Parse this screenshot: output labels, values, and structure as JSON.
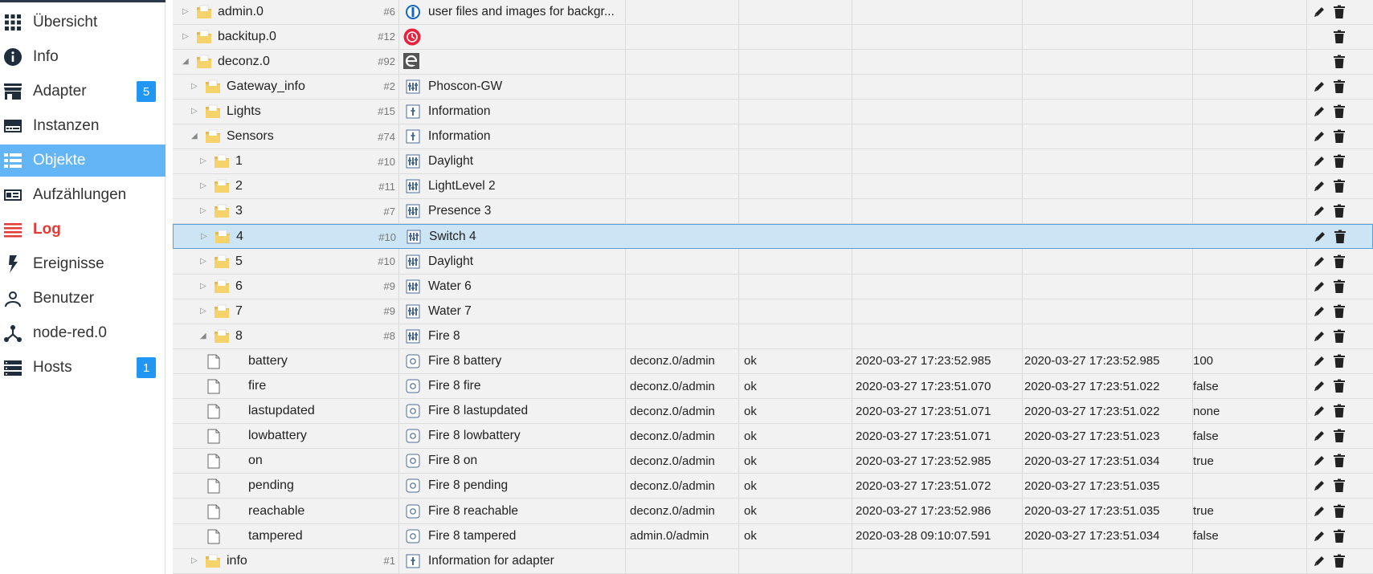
{
  "nav": [
    {
      "label": "Übersicht",
      "icon": "grid-icon"
    },
    {
      "label": "Info",
      "icon": "info-icon"
    },
    {
      "label": "Adapter",
      "icon": "store-icon",
      "badge": "5"
    },
    {
      "label": "Instanzen",
      "icon": "instances-icon"
    },
    {
      "label": "Objekte",
      "icon": "list-icon",
      "active": true
    },
    {
      "label": "Aufzählungen",
      "icon": "enum-icon"
    },
    {
      "label": "Log",
      "icon": "log-icon"
    },
    {
      "label": "Ereignisse",
      "icon": "bolt-icon"
    },
    {
      "label": "Benutzer",
      "icon": "user-icon"
    },
    {
      "label": "node-red.0",
      "icon": "node-red-icon"
    },
    {
      "label": "Hosts",
      "icon": "hosts-icon",
      "badge": "1"
    }
  ],
  "rows": [
    {
      "name": "admin.0",
      "count": "#6",
      "desc": "user files and images for backgr...",
      "type_icon": "admin-logo-icon",
      "toggle": "collapsed",
      "kind": "folder",
      "level": 0
    },
    {
      "name": "backitup.0",
      "count": "#12",
      "desc": "",
      "type_icon": "backitup-logo-icon",
      "toggle": "collapsed",
      "kind": "folder",
      "level": 0
    },
    {
      "name": "deconz.0",
      "count": "#92",
      "desc": "",
      "type_icon": "deconz-logo-icon",
      "toggle": "expanded",
      "kind": "folder",
      "level": 0
    },
    {
      "name": "Gateway_info",
      "count": "#2",
      "desc": "Phoscon-GW",
      "type_icon": "device-icon",
      "toggle": "collapsed",
      "kind": "folder",
      "level": 1
    },
    {
      "name": "Lights",
      "count": "#15",
      "desc": "Information",
      "type_icon": "channel-icon",
      "toggle": "collapsed",
      "kind": "folder",
      "level": 1
    },
    {
      "name": "Sensors",
      "count": "#74",
      "desc": "Information",
      "type_icon": "channel-icon",
      "toggle": "expanded",
      "kind": "folder",
      "level": 1
    },
    {
      "name": "1",
      "count": "#10",
      "desc": "Daylight",
      "type_icon": "device-icon",
      "toggle": "collapsed",
      "kind": "folder",
      "level": 2
    },
    {
      "name": "2",
      "count": "#11",
      "desc": "LightLevel 2",
      "type_icon": "device-icon",
      "toggle": "collapsed",
      "kind": "folder",
      "level": 2
    },
    {
      "name": "3",
      "count": "#7",
      "desc": "Presence 3",
      "type_icon": "device-icon",
      "toggle": "collapsed",
      "kind": "folder",
      "level": 2
    },
    {
      "name": "4",
      "count": "#10",
      "desc": "Switch 4",
      "type_icon": "device-icon",
      "toggle": "collapsed",
      "kind": "folder",
      "level": 2,
      "selected": true
    },
    {
      "name": "5",
      "count": "#10",
      "desc": "Daylight",
      "type_icon": "device-icon",
      "toggle": "collapsed",
      "kind": "folder",
      "level": 2
    },
    {
      "name": "6",
      "count": "#9",
      "desc": "Water 6",
      "type_icon": "device-icon",
      "toggle": "collapsed",
      "kind": "folder",
      "level": 2
    },
    {
      "name": "7",
      "count": "#9",
      "desc": "Water 7",
      "type_icon": "device-icon",
      "toggle": "collapsed",
      "kind": "folder",
      "level": 2
    },
    {
      "name": "8",
      "count": "#8",
      "desc": "Fire 8",
      "type_icon": "device-icon",
      "toggle": "expanded",
      "kind": "folder",
      "level": 2
    },
    {
      "name": "battery",
      "desc": "Fire 8 battery",
      "type_icon": "state-icon",
      "kind": "file",
      "level": 3,
      "from": "deconz.0/admin",
      "ack": "ok",
      "ts": "2020-03-27 17:23:52.985",
      "lc": "2020-03-27 17:23:52.985",
      "val": "100"
    },
    {
      "name": "fire",
      "desc": "Fire 8 fire",
      "type_icon": "state-icon",
      "kind": "file",
      "level": 3,
      "from": "deconz.0/admin",
      "ack": "ok",
      "ts": "2020-03-27 17:23:51.070",
      "lc": "2020-03-27 17:23:51.022",
      "val": "false"
    },
    {
      "name": "lastupdated",
      "desc": "Fire 8 lastupdated",
      "type_icon": "state-icon",
      "kind": "file",
      "level": 3,
      "from": "deconz.0/admin",
      "ack": "ok",
      "ts": "2020-03-27 17:23:51.071",
      "lc": "2020-03-27 17:23:51.022",
      "val": "none"
    },
    {
      "name": "lowbattery",
      "desc": "Fire 8 lowbattery",
      "type_icon": "state-icon",
      "kind": "file",
      "level": 3,
      "from": "deconz.0/admin",
      "ack": "ok",
      "ts": "2020-03-27 17:23:51.071",
      "lc": "2020-03-27 17:23:51.023",
      "val": "false"
    },
    {
      "name": "on",
      "desc": "Fire 8 on",
      "type_icon": "state-icon",
      "kind": "file",
      "level": 3,
      "from": "deconz.0/admin",
      "ack": "ok",
      "ts": "2020-03-27 17:23:52.985",
      "lc": "2020-03-27 17:23:51.034",
      "val": "true"
    },
    {
      "name": "pending",
      "desc": "Fire 8 pending",
      "type_icon": "state-icon",
      "kind": "file",
      "level": 3,
      "from": "deconz.0/admin",
      "ack": "ok",
      "ts": "2020-03-27 17:23:51.072",
      "lc": "2020-03-27 17:23:51.035",
      "val": ""
    },
    {
      "name": "reachable",
      "desc": "Fire 8 reachable",
      "type_icon": "state-icon",
      "kind": "file",
      "level": 3,
      "from": "deconz.0/admin",
      "ack": "ok",
      "ts": "2020-03-27 17:23:52.986",
      "lc": "2020-03-27 17:23:51.035",
      "val": "true"
    },
    {
      "name": "tampered",
      "desc": "Fire 8 tampered",
      "type_icon": "state-icon",
      "kind": "file",
      "level": 3,
      "from": "admin.0/admin",
      "ack": "ok",
      "ts": "2020-03-28 09:10:07.591",
      "lc": "2020-03-27 17:23:51.034",
      "val": "false"
    },
    {
      "name": "info",
      "count": "#1",
      "desc": "Information for adapter",
      "type_icon": "channel-icon",
      "toggle": "collapsed",
      "kind": "folder",
      "level": 1
    }
  ],
  "colors": {
    "accent": "#64b5f6",
    "badge": "#2196f3",
    "log": "#e53935",
    "selected_row": "#cbe5f4"
  }
}
